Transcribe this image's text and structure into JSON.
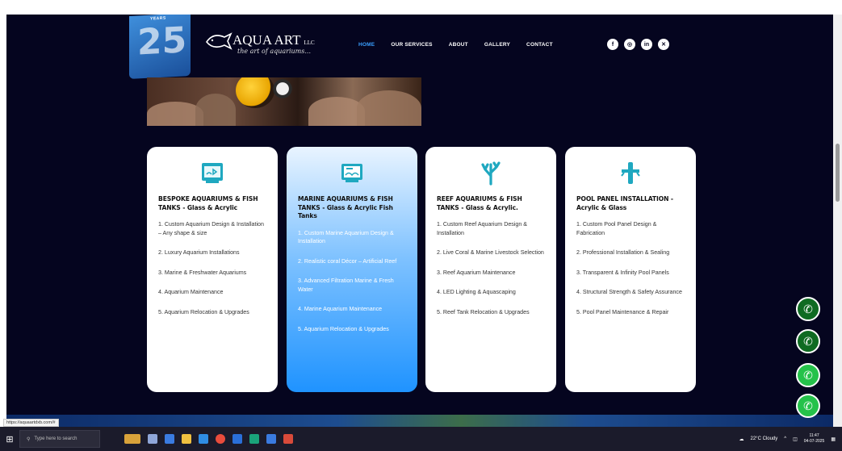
{
  "header": {
    "badge_years": "YEARS",
    "badge_number": "25",
    "logo_name": "AQUA ART",
    "logo_suffix": "LLC",
    "logo_tagline": "the art of aquariums...",
    "nav": [
      "HOME",
      "OUR SERVICES",
      "ABOUT",
      "GALLERY",
      "CONTACT"
    ],
    "active_nav": "HOME",
    "social_icons": [
      "facebook-icon",
      "instagram-icon",
      "linkedin-icon",
      "x-icon"
    ]
  },
  "cards": [
    {
      "title": "BESPOKE AQUARIUMS & FISH TANKS - Glass & Acrylic",
      "icon": "aquarium-icon",
      "items": [
        "1. Custom Aquarium Design & Installation – Any shape & size",
        "2. Luxury Aquarium Installations",
        "3. Marine & Freshwater Aquariums",
        "4. Aquarium Maintenance",
        "5. Aquarium Relocation & Upgrades"
      ]
    },
    {
      "title": "MARINE AQUARIUMS & FISH TANKS - Glass & Acrylic Fish Tanks",
      "icon": "marine-tank-icon",
      "items": [
        "1. Custom Marine Aquarium Design & Installation",
        "2. Realistic coral Décor – Artificial Reef",
        "3. Advanced Filtration Marine & Fresh Water",
        "4. Marine Aquarium Maintenance",
        "5. Aquarium Relocation & Upgrades"
      ]
    },
    {
      "title": "REEF AQUARIUMS & FISH TANKS - Glass & Acrylic.",
      "icon": "coral-icon",
      "items": [
        "1. Custom Reef Aquarium Design & Installation",
        "2. Live Coral & Marine Livestock Selection",
        "3. Reef Aquarium Maintenance",
        "4. LED Lighting & Aquascaping",
        "5. Reef Tank Relocation & Upgrades"
      ]
    },
    {
      "title": "POOL PANEL INSTALLATION - Acrylic & Glass",
      "icon": "pool-panel-icon",
      "items": [
        "1. Custom Pool Panel Design & Fabrication",
        "2. Professional Installation & Sealing",
        "3. Transparent & Infinity Pool Panels",
        "4. Structural Strength & Safety Assurance",
        "5. Pool Panel Maintenance & Repair"
      ]
    }
  ],
  "status_url": "https://aquaartdxb.com/#",
  "taskbar": {
    "search_placeholder": "Type here to search",
    "weather": "22°C Cloudy",
    "time": "11:47",
    "date": "04-07-2025"
  },
  "colors": {
    "page_bg": "#05051f",
    "accent_blue": "#1f93ff",
    "icon_teal": "#1fa8c0",
    "phone_green": "#0f6b22",
    "whatsapp_green": "#25c24a"
  }
}
